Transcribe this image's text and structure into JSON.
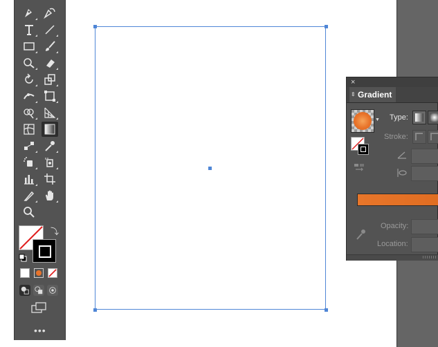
{
  "toolbar": {
    "tools": [
      {
        "name": "pen-tool",
        "icon": "pen-icon"
      },
      {
        "name": "curvature-tool",
        "icon": "curvature-pen-icon"
      },
      {
        "name": "type-tool",
        "icon": "type-T-icon"
      },
      {
        "name": "line-segment-tool",
        "icon": "line-icon"
      },
      {
        "name": "rectangle-tool",
        "icon": "rectangle-icon"
      },
      {
        "name": "paintbrush-tool",
        "icon": "brush-icon"
      },
      {
        "name": "shaper-tool",
        "icon": "shaper-icon"
      },
      {
        "name": "eraser-tool",
        "icon": "eraser-icon"
      },
      {
        "name": "rotate-tool",
        "icon": "rotate-icon"
      },
      {
        "name": "scale-tool",
        "icon": "scale-icon"
      },
      {
        "name": "width-tool",
        "icon": "width-icon"
      },
      {
        "name": "free-transform-tool",
        "icon": "free-transform-icon"
      },
      {
        "name": "shape-builder-tool",
        "icon": "shape-builder-icon"
      },
      {
        "name": "perspective-grid-tool",
        "icon": "perspective-grid-icon"
      },
      {
        "name": "mesh-tool",
        "icon": "mesh-icon"
      },
      {
        "name": "gradient-tool",
        "icon": "gradient-icon",
        "active": true
      },
      {
        "name": "blend-tool",
        "icon": "blend-icon"
      },
      {
        "name": "eyedropper-tool",
        "icon": "eyedropper-icon"
      },
      {
        "name": "symbol-sprayer-tool",
        "icon": "symbol-sprayer-icon"
      },
      {
        "name": "live-paint-tool",
        "icon": "live-paint-icon"
      },
      {
        "name": "column-graph-tool",
        "icon": "graph-icon"
      },
      {
        "name": "artboard-tool",
        "icon": "artboard-icon"
      },
      {
        "name": "slice-tool",
        "icon": "slice-icon"
      },
      {
        "name": "hand-tool",
        "icon": "hand-icon"
      },
      {
        "name": "zoom-tool",
        "icon": "zoom-icon"
      }
    ],
    "more_label": "•••"
  },
  "colors": {
    "toolbar_bg": "#535353",
    "artboard_border": "#4f86d6",
    "gradient_orange": "#e8762a",
    "none_red": "#e02020"
  },
  "gradient_panel": {
    "close_label": "×",
    "tab_label": "Gradient",
    "type_label": "Type:",
    "stroke_label": "Stroke:",
    "opacity_label": "Opacity:",
    "location_label": "Location:"
  }
}
